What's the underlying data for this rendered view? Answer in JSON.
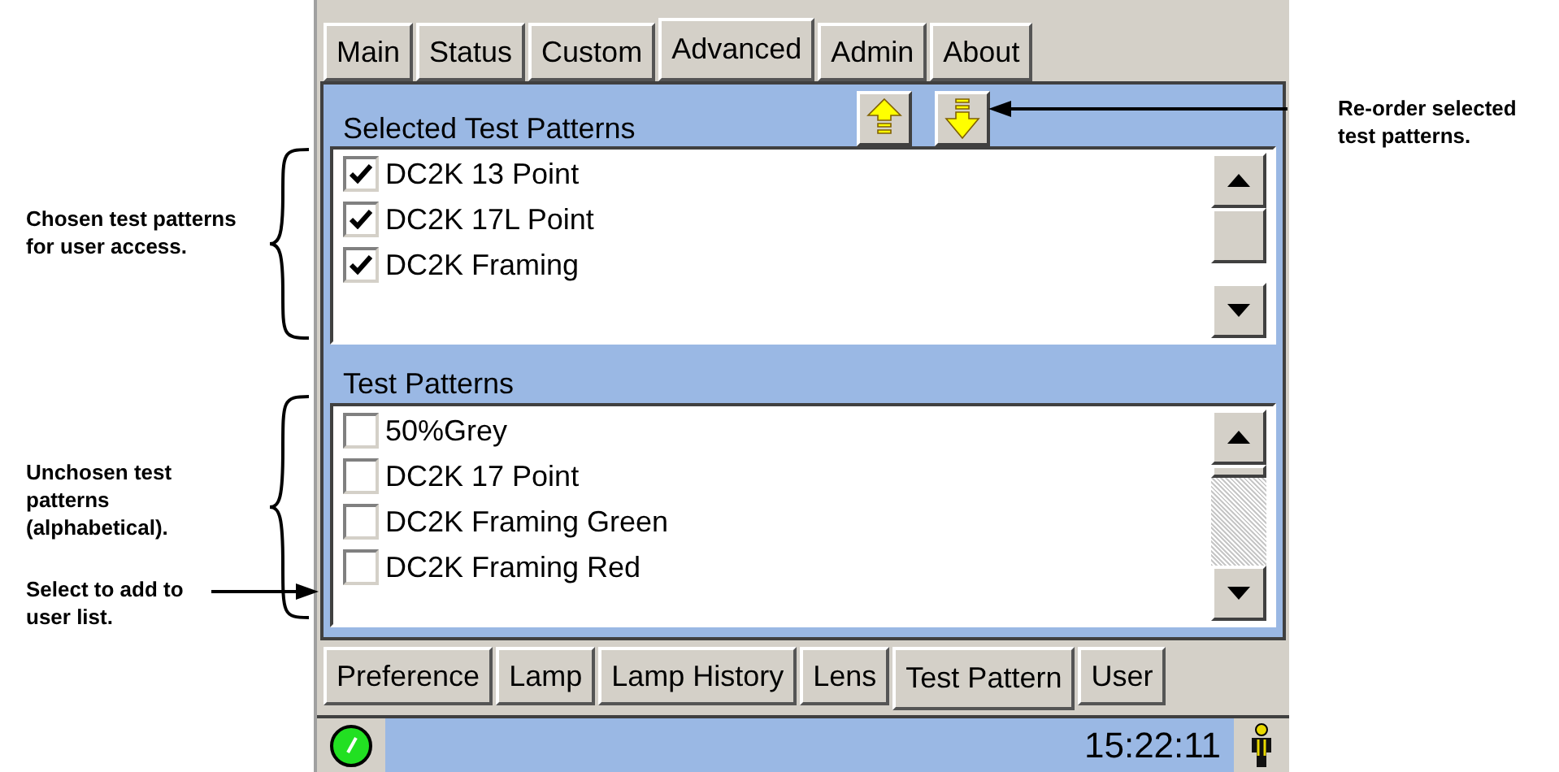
{
  "top_tabs": [
    {
      "label": "Main",
      "selected": false
    },
    {
      "label": "Status",
      "selected": false
    },
    {
      "label": "Custom",
      "selected": false
    },
    {
      "label": "Advanced",
      "selected": true
    },
    {
      "label": "Admin",
      "selected": false
    },
    {
      "label": "About",
      "selected": false
    }
  ],
  "selected_patterns": {
    "title": "Selected Test Patterns",
    "items": [
      {
        "label": "DC2K 13 Point",
        "checked": true
      },
      {
        "label": "DC2K 17L Point",
        "checked": true
      },
      {
        "label": "DC2K Framing",
        "checked": true
      }
    ]
  },
  "test_patterns": {
    "title": "Test Patterns",
    "items": [
      {
        "label": "50%Grey",
        "checked": false
      },
      {
        "label": "DC2K 17 Point",
        "checked": false
      },
      {
        "label": "DC2K Framing Green",
        "checked": false
      },
      {
        "label": "DC2K Framing Red",
        "checked": false
      }
    ]
  },
  "bottom_tabs": [
    {
      "label": "Preference",
      "selected": false
    },
    {
      "label": "Lamp",
      "selected": false
    },
    {
      "label": "Lamp History",
      "selected": false
    },
    {
      "label": "Lens",
      "selected": false
    },
    {
      "label": "Test Pattern",
      "selected": true
    },
    {
      "label": "User",
      "selected": false
    }
  ],
  "status_bar": {
    "time": "15:22:11"
  },
  "annotations": {
    "chosen": "Chosen test patterns for user access.",
    "unchosen": "Unchosen test patterns (alphabetical).",
    "select": "Select to add to user list.",
    "reorder": "Re-order selected test patterns."
  }
}
